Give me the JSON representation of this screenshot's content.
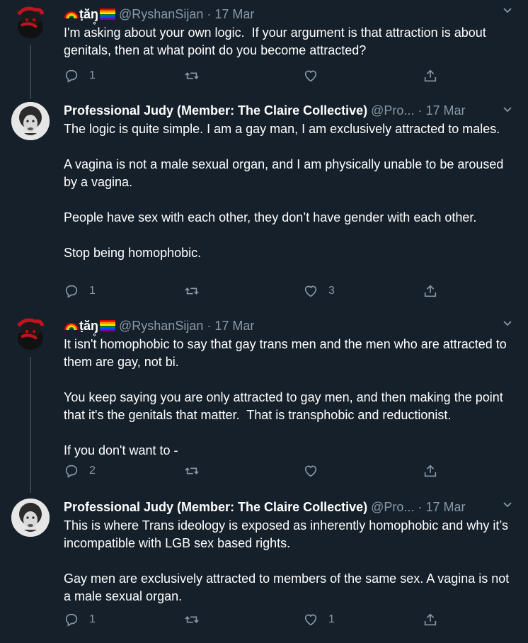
{
  "tweets": [
    {
      "display_name": "𝕥̣ă̌n̥",
      "name_text": "ṭă̆ŋ̥",
      "handle": "@RyshanSijan",
      "sep": "·",
      "date": "17 Mar",
      "text": "I'm asking about your own logic.  If your argument is that attraction is about genitals, then at what point do you become attracted?",
      "replies": "1",
      "retweets": "",
      "likes": ""
    },
    {
      "display_name": "Professional Judy (Member: The Claire Collective)",
      "handle": "@Pro...",
      "sep": "·",
      "date": "17 Mar",
      "text": "The logic is quite simple. I am a gay man, I am exclusively attracted to males.\n\nA vagina is not a male sexual organ, and I am physically unable to be aroused by a vagina.\n\nPeople have sex with each other, they don’t have gender with each other.\n\nStop being homophobic.",
      "replies": "1",
      "retweets": "",
      "likes": "3"
    },
    {
      "display_name": "ṭă̆ŋ̥",
      "name_text": "ṭă̆ŋ̥",
      "handle": "@RyshanSijan",
      "sep": "·",
      "date": "17 Mar",
      "text": "It isn't homophobic to say that gay trans men and the men who are attracted to them are gay, not bi.\n\nYou keep saying you are only attracted to gay men, and then making the point that it's the genitals that matter.  That is transphobic and reductionist.\n\nIf you don't want to -",
      "replies": "2",
      "retweets": "",
      "likes": ""
    },
    {
      "display_name": "Professional Judy (Member: The Claire Collective)",
      "handle": "@Pro...",
      "sep": "·",
      "date": "17 Mar",
      "text": "This is where Trans ideology is exposed as inherently homophobic and why it’s incompatible with LGB sex based rights.\n\nGay men are exclusively attracted to members of the same sex. A vagina is not a male sexual organ.",
      "replies": "1",
      "retweets": "",
      "likes": "1"
    }
  ],
  "icons": {
    "reply": "reply-icon",
    "retweet": "retweet-icon",
    "like": "heart-icon",
    "share": "share-icon",
    "more": "chevron-down-icon"
  },
  "colors": {
    "background": "#15202b",
    "text": "#ffffff",
    "muted": "#8899a6",
    "thread_line": "#38444d"
  }
}
